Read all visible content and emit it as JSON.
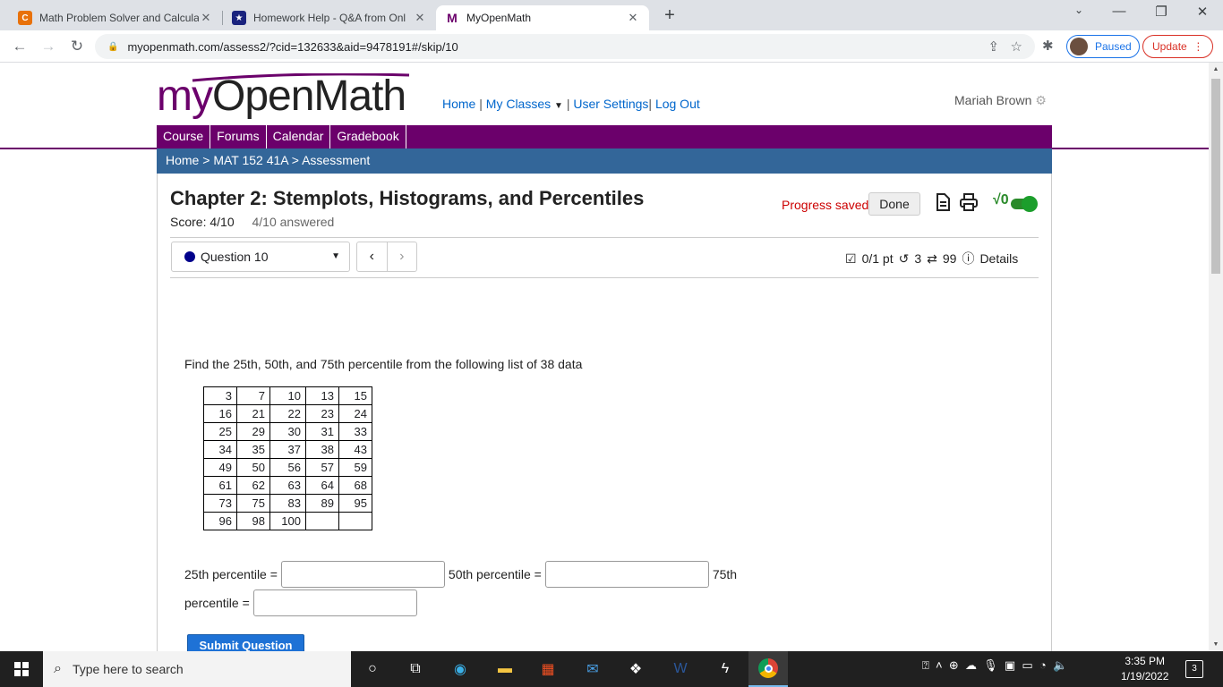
{
  "browser": {
    "tabs": [
      {
        "title": "Math Problem Solver and Calcula",
        "favicon": "C",
        "favicon_color": "#e8710a"
      },
      {
        "title": "Homework Help - Q&A from Onl",
        "favicon": "★",
        "favicon_color": "#1a237e"
      },
      {
        "title": "MyOpenMath",
        "favicon": "M",
        "favicon_color": "#6b006b"
      }
    ],
    "url": "myopenmath.com/assess2/?cid=132633&aid=9478191#/skip/10",
    "profile_status": "Paused",
    "update_label": "Update"
  },
  "site": {
    "logo_my": "my",
    "logo_openmath": "OpenMath",
    "nav": {
      "home": "Home",
      "sep": "|",
      "classes": "My Classes",
      "settings": "User Settings",
      "logout": "Log Out"
    },
    "user_name": "Mariah Brown",
    "menu": [
      "Course",
      "Forums",
      "Calendar",
      "Gradebook"
    ],
    "breadcrumb": {
      "home": "Home",
      "course": "MAT 152 41A",
      "current": "Assessment",
      "sep": ">"
    }
  },
  "assessment": {
    "title": "Chapter 2: Stemplots, Histograms, and Percentiles",
    "score": "Score: 4/10",
    "answered": "4/10 answered",
    "progress": "Progress saved",
    "done_label": "Done",
    "sqrt_label": "√0",
    "question_select": "Question 10",
    "points": "0/1 pt",
    "retries": "3",
    "attempts": "99",
    "details": "Details"
  },
  "question": {
    "prompt": "Find the 25th, 50th, and 75th percentile from the following list of 38 data",
    "table": [
      [
        "3",
        "7",
        "10",
        "13",
        "15"
      ],
      [
        "16",
        "21",
        "22",
        "23",
        "24"
      ],
      [
        "25",
        "29",
        "30",
        "31",
        "33"
      ],
      [
        "34",
        "35",
        "37",
        "38",
        "43"
      ],
      [
        "49",
        "50",
        "56",
        "57",
        "59"
      ],
      [
        "61",
        "62",
        "63",
        "64",
        "68"
      ],
      [
        "73",
        "75",
        "83",
        "89",
        "95"
      ],
      [
        "96",
        "98",
        "100",
        "",
        ""
      ]
    ],
    "label_25": "25th percentile =",
    "label_50": "50th percentile =",
    "label_75a": "75th",
    "label_75b": "percentile =",
    "answer_25": "",
    "answer_50": "",
    "answer_75": "",
    "submit_label": "Submit Question"
  },
  "taskbar": {
    "search_placeholder": "Type here to search",
    "time": "3:35 PM",
    "date": "1/19/2022",
    "notifications": "3"
  }
}
